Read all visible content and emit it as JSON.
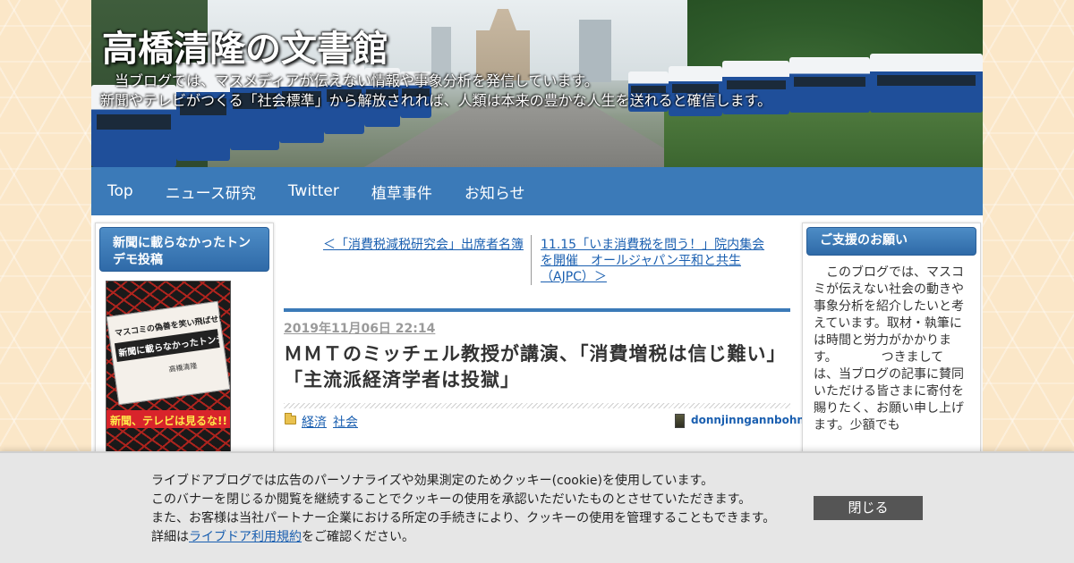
{
  "header": {
    "site_title": "高橋清隆の文書館",
    "description_line1": "　当ブログでは、マスメディアが伝えない情報や事象分析を発信しています。",
    "description_line2": "新聞やテレビがつくる「社会標準」から解放されれば、人類は本来の豊かな人生を送れると確信します。"
  },
  "nav": {
    "items": [
      {
        "label": "Top"
      },
      {
        "label": "ニュース研究"
      },
      {
        "label": "Twitter"
      },
      {
        "label": "植草事件"
      },
      {
        "label": "お知らせ"
      }
    ]
  },
  "left_sidebar": {
    "title": "新聞に載らなかったトンデモ投稿",
    "book": {
      "tagline": "マスコミの偽善を笑い飛ばせ!",
      "title": "新聞に載らなかったトンデモ投稿",
      "author": "高橋清隆",
      "banner": "新聞、テレビは見るな!!"
    }
  },
  "pager": {
    "prev": "＜「消費税減税研究会」出席者名簿",
    "next": "11.15「いま消費税を問う！」院内集会を開催　オールジャパン平和と共生（AJPC）＞"
  },
  "post": {
    "date": "2019年11月06日 22:14",
    "title": "ＭＭＴのミッチェル教授が講演、「消費増税は信じ難い」「主流派経済学者は投獄」",
    "categories": [
      "経済",
      "社会"
    ],
    "author": "donnjinngannbohnn"
  },
  "right_sidebar": {
    "title": "ご支援のお願い",
    "text": "　このブログでは、マスコミが伝えない社会の動きや事象分析を紹介したいと考えています。取材・執筆には時間と労力がかかりま\nす。　　　　つきましては、当ブログの記事に賛同いただける皆さまに寄付を賜りたく、お願い申し上げます。少額でも"
  },
  "cookie_banner": {
    "line1": "ライブドアブログでは広告のパーソナライズや効果測定のためクッキー(cookie)を使用しています。",
    "line2": "このバナーを閉じるか閲覧を継続することでクッキーの使用を承認いただいたものとさせていただきます。",
    "line3": "また、お客様は当社パートナー企業における所定の手続きにより、クッキーの使用を管理することもできます。",
    "line4_prefix": "詳細は",
    "line4_link": "ライブドア利用規約",
    "line4_suffix": "をご確認ください。",
    "close_label": "閉じる"
  },
  "colors": {
    "nav_bg": "#3b7ab8",
    "link": "#1a5fb0",
    "sidebar_title_bg": "#3b7ab8",
    "close_button_bg": "#555555"
  }
}
